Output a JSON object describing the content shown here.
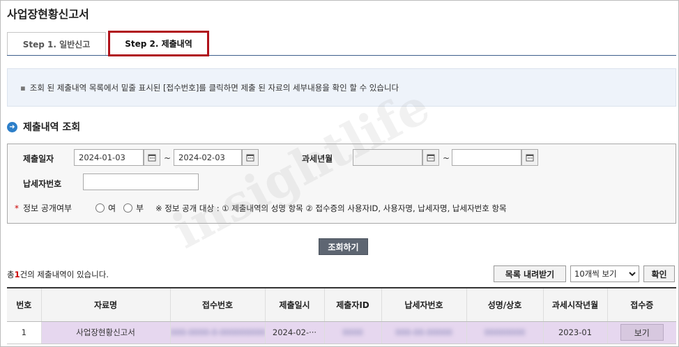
{
  "page": {
    "title": "사업장현황신고서"
  },
  "tabs": [
    {
      "label": "Step 1. 일반신고",
      "active": false
    },
    {
      "label": "Step 2. 제출내역",
      "active": true
    }
  ],
  "info": {
    "bullet": "▪",
    "text": "조회 된 제출내역 목록에서 밑줄 표시된 [접수번호]를 클릭하면 제출 된 자료의 세부내용을 확인 할 수 있습니다"
  },
  "section": {
    "title": "제출내역 조회",
    "icon": "arrow-circle-icon"
  },
  "search": {
    "submit_date_label": "제출일자",
    "submit_date_from": "2024-01-03",
    "submit_date_to": "2024-02-03",
    "tilde": "~",
    "tax_period_label": "과세년월",
    "tax_period_from": "",
    "tax_period_to": "",
    "taxpayer_no_label": "납세자번호",
    "taxpayer_no_value": "",
    "disclosure_required": "*",
    "disclosure_label": "정보 공개여부",
    "option_yes": "여",
    "option_no": "부",
    "disclosure_note": "※ 정보 공개 대상 : ① 제출내역의 성명 항목 ② 접수증의 사용자ID, 사용자명, 납세자명, 납세자번호 항목",
    "search_button": "조회하기"
  },
  "results": {
    "count_prefix": "총",
    "count": "1",
    "count_suffix": "건의 제출내역이 있습니다.",
    "download_button": "목록 내려받기",
    "page_size": "10개씩 보기",
    "confirm_button": "확인",
    "columns": [
      "번호",
      "자료명",
      "접수번호",
      "제출일시",
      "제출자ID",
      "납세자번호",
      "성명/상호",
      "과세시작년월",
      "접수증"
    ],
    "rows": [
      {
        "no": "1",
        "doc_name": "사업장현황신고서",
        "receipt_no": "000-0000-0-000000000",
        "submit_time": "2024-02-···",
        "submitter_id": "0000",
        "taxpayer_no": "000-00-00000",
        "name": "00000000",
        "tax_start": "2023-01",
        "receipt_button": "보기"
      }
    ]
  },
  "watermark": "insightlife"
}
